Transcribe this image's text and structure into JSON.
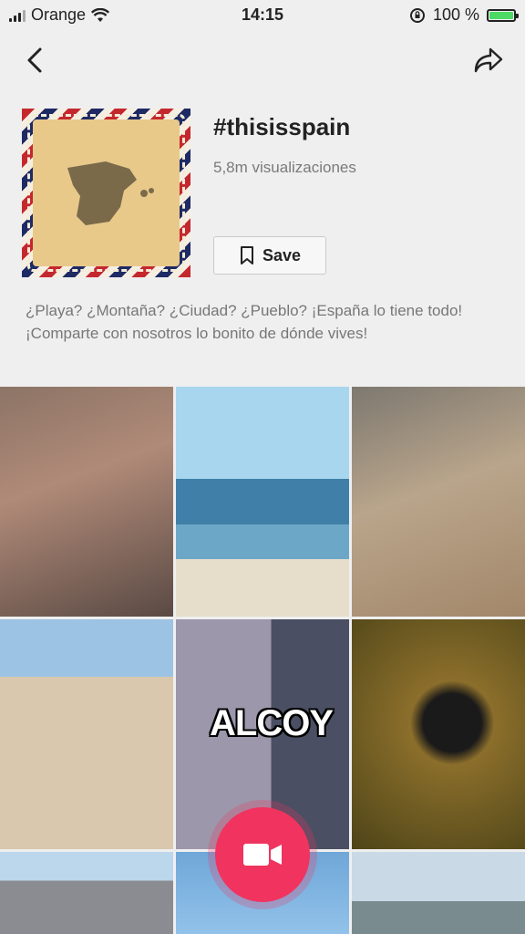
{
  "status": {
    "carrier": "Orange",
    "time": "14:15",
    "battery": "100 %",
    "battery_level": 1.0
  },
  "nav": {
    "back_icon": "chevron-left-icon",
    "share_icon": "share-arrow-icon"
  },
  "hashtag": {
    "title": "#thisisspain",
    "views": "5,8m visualizaciones",
    "save_label": "Save",
    "description_line1": "¿Playa? ¿Montaña? ¿Ciudad? ¿Pueblo? ¡España lo tiene todo!",
    "description_line2": "¡Comparte con nosotros lo bonito de dónde vives!"
  },
  "grid": {
    "overlay_text": "ALCOY"
  },
  "colors": {
    "accent": "#f0345f",
    "background": "#efefef"
  }
}
